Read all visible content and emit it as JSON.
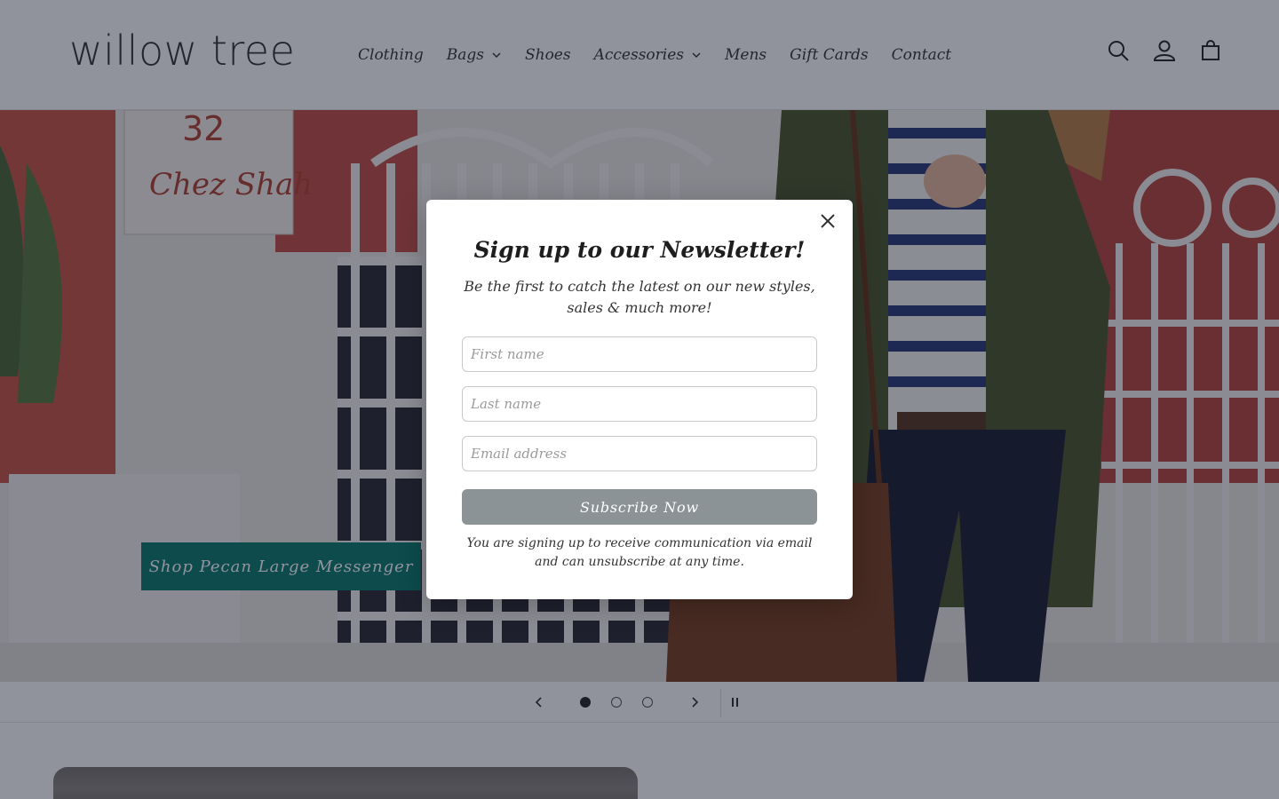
{
  "header": {
    "logo": "willow tree",
    "nav": [
      {
        "label": "Clothing",
        "dropdown": false
      },
      {
        "label": "Bags",
        "dropdown": true
      },
      {
        "label": "Shoes",
        "dropdown": false
      },
      {
        "label": "Accessories",
        "dropdown": true
      },
      {
        "label": "Mens",
        "dropdown": false
      },
      {
        "label": "Gift Cards",
        "dropdown": false
      },
      {
        "label": "Contact",
        "dropdown": false
      }
    ],
    "icons": [
      "search-icon",
      "account-icon",
      "cart-icon"
    ]
  },
  "hero": {
    "cta_label": "Shop Pecan Large Messenger",
    "sign_number": "32",
    "sign_name": "Chez Shah",
    "slides_total": 3,
    "active_slide": 1
  },
  "colors": {
    "accent": "#0f7d6e",
    "button_gray": "#8c9396",
    "overlay": "rgba(10,15,35,0.45)"
  },
  "modal": {
    "title": "Sign up to our Newsletter!",
    "subtitle": "Be the first to catch the latest on our new styles, sales & much more!",
    "first_name_placeholder": "First name",
    "last_name_placeholder": "Last name",
    "email_placeholder": "Email address",
    "subscribe_label": "Subscribe Now",
    "note": "You are signing up to receive communication via email and can unsubscribe at any time."
  }
}
